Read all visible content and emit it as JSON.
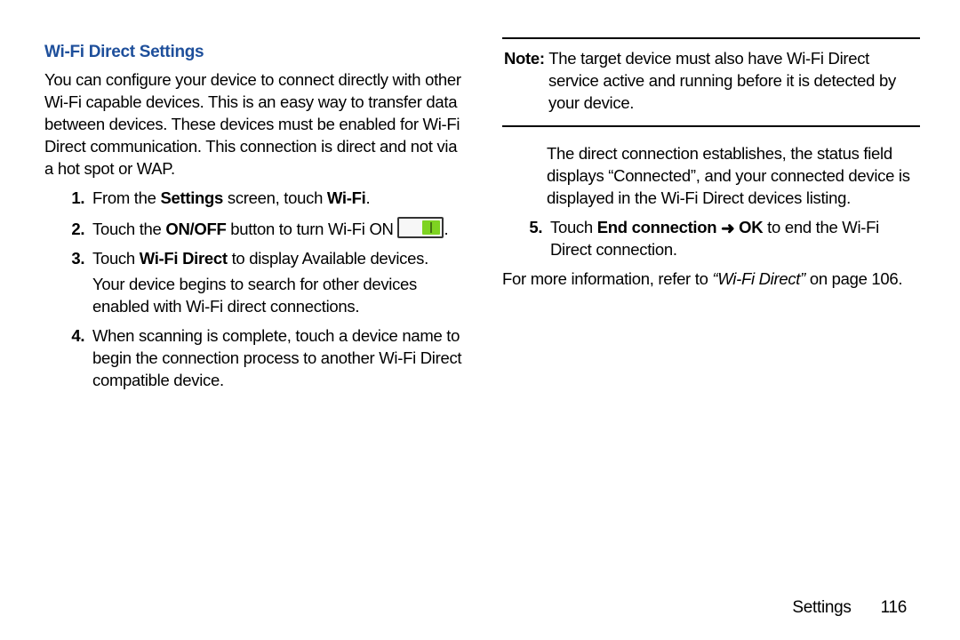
{
  "heading": "Wi-Fi Direct Settings",
  "intro": "You can configure your device to connect directly with other Wi-Fi capable devices. This is an easy way to transfer data between devices. These devices must be enabled for Wi-Fi Direct communication. This connection is direct and not via a hot spot or WAP.",
  "steps": {
    "s1a": "From the ",
    "s1_bold1": "Settings",
    "s1b": " screen, touch ",
    "s1_bold2": "Wi-Fi",
    "s1c": ".",
    "s2a": "Touch the ",
    "s2_bold": "ON/OFF",
    "s2b": " button to turn Wi-Fi ON ",
    "s2c": ".",
    "s3a": "Touch ",
    "s3_bold": "Wi-Fi Direct",
    "s3b": " to display Available devices.",
    "s3_sub": "Your device begins to search for other devices enabled with Wi-Fi direct connections.",
    "s4": "When scanning is complete, touch a device name to begin the connection process to another Wi-Fi Direct compatible device.",
    "s5a": "Touch ",
    "s5_bold1": "End connection",
    "s5_arrow": "➜",
    "s5_bold2": "OK",
    "s5b": " to end the Wi-Fi Direct connection."
  },
  "note": {
    "label": "Note:",
    "text": " The target device must also have Wi-Fi Direct service active and running before it is detected by your device."
  },
  "after_note": "The direct connection establishes, the status field displays “Connected”, and your connected device is displayed in the Wi-Fi Direct devices listing.",
  "moreinfo": {
    "a": "For more information, refer to ",
    "italic": "“Wi-Fi Direct”",
    "b": " on page 106."
  },
  "footer": {
    "section": "Settings",
    "page": "116"
  }
}
